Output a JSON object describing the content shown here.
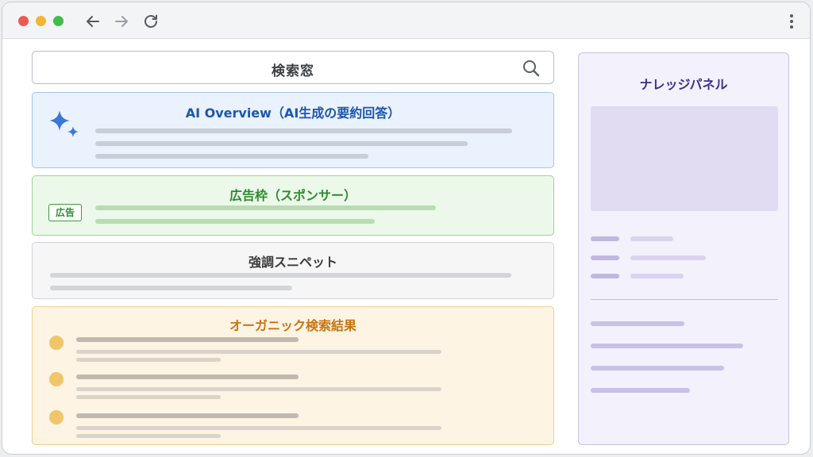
{
  "browser": {
    "icons": {
      "back": "arrow-left-icon",
      "forward": "arrow-right-icon",
      "reload": "reload-icon",
      "menu": "kebab-menu-icon"
    }
  },
  "search": {
    "label": "検索窓",
    "icon": "search-icon"
  },
  "ai_overview": {
    "title": "AI Overview（AI生成の要約回答）",
    "icon": "sparkle-icon",
    "accent": "#1c56b0"
  },
  "ad_block": {
    "title": "広告枠（スポンサー）",
    "badge": "広告",
    "accent": "#2e8b2e"
  },
  "featured_snippet": {
    "title": "強調スニペット"
  },
  "organic_results": {
    "title": "オーガニック検索結果",
    "accent": "#c87412"
  },
  "knowledge_panel": {
    "title": "ナレッジパネル",
    "accent": "#3f2f8f"
  }
}
